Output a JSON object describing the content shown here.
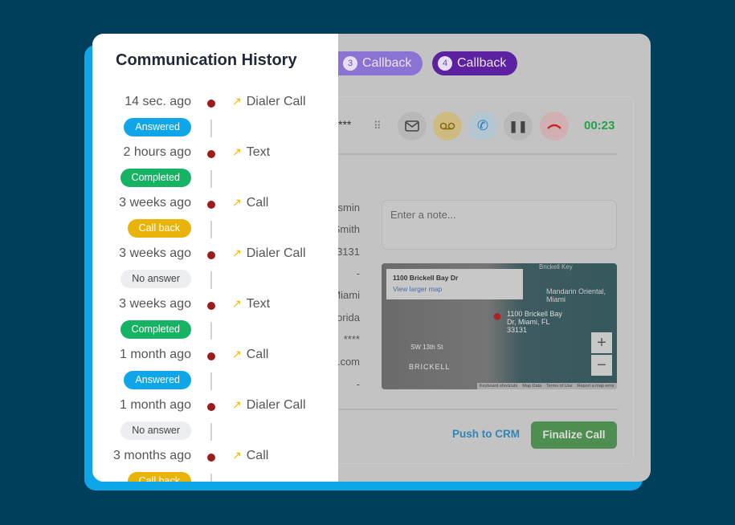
{
  "history": {
    "title": "Communication History",
    "items": [
      {
        "time": "14 sec. ago",
        "type": "Dialer Call",
        "status": "Answered",
        "color": "#0ea5e9"
      },
      {
        "time": "2 hours ago",
        "type": "Text",
        "status": "Completed",
        "color": "#16b364"
      },
      {
        "time": "3 weeks ago",
        "type": "Call",
        "status": "Call back",
        "color": "#eab308"
      },
      {
        "time": "3 weeks ago",
        "type": "Dialer Call",
        "status": "No answer",
        "color": "#eceef2"
      },
      {
        "time": "3 weeks ago",
        "type": "Text",
        "status": "Completed",
        "color": "#16b364"
      },
      {
        "time": "1 month ago",
        "type": "Call",
        "status": "Answered",
        "color": "#0ea5e9"
      },
      {
        "time": "1 month ago",
        "type": "Dialer Call",
        "status": "No answer",
        "color": "#eceef2"
      },
      {
        "time": "3 months ago",
        "type": "Call",
        "status": "Call back",
        "color": "#eab308"
      }
    ]
  },
  "pills": [
    {
      "n": "3",
      "label": "Callback",
      "color": "#8b73d4"
    },
    {
      "n": "4",
      "label": "Callback",
      "color": "#5b21a0"
    }
  ],
  "call": {
    "masked": "***",
    "timer": "00:23",
    "icons": [
      "dialpad-icon",
      "email-icon",
      "voicemail-icon",
      "transfer-call-icon",
      "pause-icon",
      "hang-up-icon"
    ]
  },
  "contact_fields": [
    "smin",
    "Smith",
    "33131",
    "-",
    "Miami",
    "orida",
    "****",
    ".com",
    "-"
  ],
  "note_placeholder": "Enter a note...",
  "map": {
    "address": "1100 Brickell Bay Dr",
    "link": "View larger map",
    "pin_label": "1100 Brickell Bay Dr, Miami, FL 33131",
    "poi": "Mandarin Oriental, Miami",
    "area": "BRICKELL",
    "top_label": "Brickell Key",
    "street": "SW 13th St",
    "footer": [
      "Keyboard shortcuts",
      "Map Data",
      "Terms of Use",
      "Report a map error"
    ],
    "zoom_in": "+",
    "zoom_out": "−"
  },
  "actions": {
    "push": "Push to CRM",
    "finalize": "Finalize Call"
  }
}
